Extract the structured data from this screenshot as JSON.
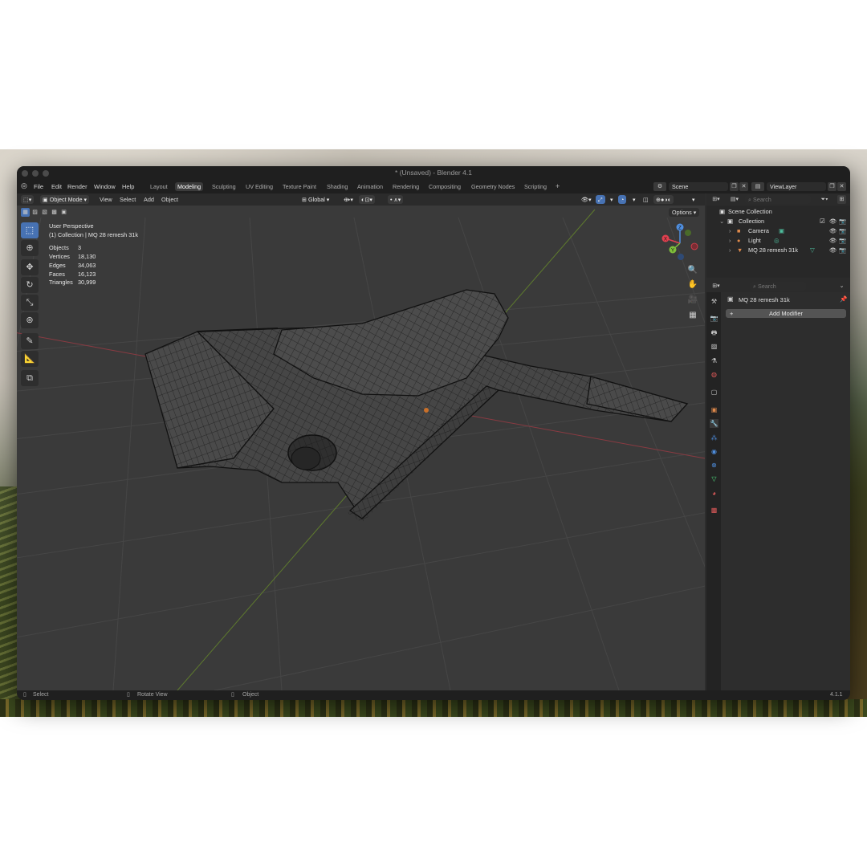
{
  "window": {
    "title": "* (Unsaved) - Blender 4.1"
  },
  "topbar": {
    "menus": [
      "File",
      "Edit",
      "Render",
      "Window",
      "Help"
    ],
    "workspaces": [
      "Layout",
      "Modeling",
      "Sculpting",
      "UV Editing",
      "Texture Paint",
      "Shading",
      "Animation",
      "Rendering",
      "Compositing",
      "Geometry Nodes",
      "Scripting"
    ],
    "active_workspace": "Modeling",
    "add_workspace": "+",
    "scene": "Scene",
    "view_layer": "ViewLayer"
  },
  "viewport_header": {
    "mode": "Object Mode",
    "menus": [
      "View",
      "Select",
      "Add",
      "Object"
    ],
    "orientation": "Global",
    "options": "Options"
  },
  "viewport_overlay": {
    "perspective": "User Perspective",
    "context": "(1) Collection | MQ 28 remesh 31k",
    "stats": [
      {
        "label": "Objects",
        "value": "3"
      },
      {
        "label": "Vertices",
        "value": "18,130"
      },
      {
        "label": "Edges",
        "value": "34,063"
      },
      {
        "label": "Faces",
        "value": "16,123"
      },
      {
        "label": "Triangles",
        "value": "30,999"
      }
    ]
  },
  "gizmo": {
    "x": "X",
    "y": "Y",
    "z": "Z"
  },
  "outliner": {
    "search_placeholder": "Search",
    "scene_collection": "Scene Collection",
    "collection": "Collection",
    "items": [
      {
        "name": "Camera",
        "icon": "camera-icon"
      },
      {
        "name": "Light",
        "icon": "light-icon"
      },
      {
        "name": "MQ 28 remesh 31k",
        "icon": "mesh-icon"
      }
    ]
  },
  "properties": {
    "search_placeholder": "Search",
    "object_name": "MQ 28 remesh 31k",
    "add_modifier": "Add Modifier",
    "add_modifier_plus": "+"
  },
  "statusbar": {
    "select": "Select",
    "rotate_view": "Rotate View",
    "object": "Object",
    "version": "4.1.1"
  },
  "colors": {
    "accent": "#4772b3",
    "x_axis": "#e0404f",
    "y_axis": "#7fbf3a",
    "z_axis": "#4f8fe0"
  }
}
